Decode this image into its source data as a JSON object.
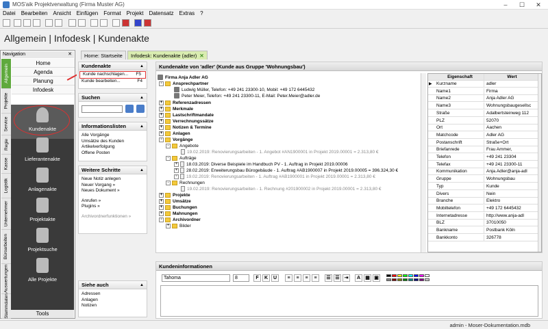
{
  "window": {
    "title": "MOS'aik Projektverwaltung (Firma Muster AG)",
    "minimize": "–",
    "maximize": "☐",
    "close": "✕"
  },
  "menu": [
    "Datei",
    "Bearbeiten",
    "Ansicht",
    "Einfügen",
    "Format",
    "Projekt",
    "Datensatz",
    "Extras",
    "?"
  ],
  "breadcrumb": "Allgemein | Infodesk | Kundenakte",
  "nav": {
    "header": "Navigation",
    "vtabs": [
      "Allgemein",
      "Projekte",
      "Service",
      "Regie",
      "Kasse",
      "Logistik",
      "Unternehmer",
      "Büroarbeiten",
      "Auswertungen",
      "Stammdaten"
    ],
    "items": [
      "Home",
      "Agenda",
      "Planung",
      "Infodesk"
    ],
    "big_items": [
      "Kundenakte",
      "Lieferantenakte",
      "Anlagenakte",
      "Projektakte",
      "Projektsuche",
      "Alle Projekte"
    ],
    "tools": "Tools"
  },
  "tabs": {
    "home": "Home: Startseite",
    "active": "Infodesk: Kundenakte (adler)"
  },
  "sidebar": {
    "kundenakte": {
      "title": "Kundenakte",
      "items": [
        {
          "label": "Kunde nachschlagen...",
          "key": "F5"
        },
        {
          "label": "Kunde bearbeiten...",
          "key": "F4"
        }
      ]
    },
    "suchen": {
      "title": "Suchen"
    },
    "infolisten": {
      "title": "Informationslisten",
      "items": [
        "Alle Vorgänge",
        "Umsätze des Kunden",
        "Artikelverfolgung",
        "Offene Posten"
      ]
    },
    "weitere": {
      "title": "Weitere Schritte",
      "items": [
        "Neue Notiz anlegen",
        "Neuer Vorgang »",
        "Neues Dokument »",
        "Anrufen »",
        "Plugins »",
        "Archivordnerfunktionen »"
      ]
    },
    "siehe": {
      "title": "Siehe auch",
      "items": [
        "Adressen",
        "Anlagen",
        "Notizen"
      ]
    }
  },
  "main": {
    "header": "Kundenakte von 'adler' (Kunde aus Gruppe 'Wohnungsbau')",
    "tree": {
      "root": "Firma Anja Adler AG",
      "ansprechpartner": "Ansprechpartner",
      "contacts": [
        "Ludwig Müller, Telefon: +49 241 23300-10, Mobil: +49 172 6445432",
        "Peter Meier, Telefon: +49 241 23300-11, E-Mail: Peter.Meier@adler.de"
      ],
      "sections": [
        "Referenzadressen",
        "Merkmale",
        "Lastschriftmandate",
        "Verrechnungssätze",
        "Notizen & Termine",
        "Anlagen"
      ],
      "vorgaenge": "Vorgänge",
      "angebote": "Angebote",
      "angebot1": "19.02.2019: Renovierungsarbeiten - 1. Angebot #AN1900001 in Projekt 2019.00001 = 2.313,80 €",
      "auftraege": "Aufträge",
      "auftrag1": "18.03.2019: Diverse Beispiele im Handbuch PV - 1. Auftrag in Projekt 2019.00006",
      "auftrag2": "28.02.2019: Erweiterungsbau Bürogebäude - 1. Auftrag #AB1900007 in Projekt 2019.00005 = 396.324,30 €",
      "auftrag3": "19.02.2019: Renovierungsarbeiten - 1. Auftrag #AB1900001 in Projekt 2019.00001 = 2.313,80 €",
      "rechnungen": "Rechnungen",
      "rechnung1": "19.02.2019: Renovierungsarbeiten - 1. Rechnung #201900002 in Projekt 2019.00001 = 2.313,80 €",
      "after": [
        "Projekte",
        "Umsätze",
        "Buchungen",
        "Mahnungen"
      ],
      "archiv": "Archivordner",
      "bilder": "Bilder"
    },
    "props": {
      "col_key": "Eigenschaft",
      "col_val": "Wert",
      "rows": [
        [
          "Kurzname",
          "adler"
        ],
        [
          "Name1",
          "Firma"
        ],
        [
          "Name2",
          "Anja Adler AG"
        ],
        [
          "Name3",
          "Wohnungsbaugesellsc"
        ],
        [
          "Straße",
          "Adalbertsteinweg 112"
        ],
        [
          "PLZ",
          "52070"
        ],
        [
          "Ort",
          "Aachen"
        ],
        [
          "Matchcode",
          "Adler AG"
        ],
        [
          "Postanschrift",
          "Straße+Ort"
        ],
        [
          "Briefanrede",
          "Frau Ammer,"
        ],
        [
          "Telefon",
          "+49 241 23304"
        ],
        [
          "Telefax",
          "+49 241 23300-11"
        ],
        [
          "Kommunikation",
          "Anja.Adler@anja-adl"
        ],
        [
          "Gruppe",
          "Wohnungsbau"
        ],
        [
          "Typ",
          "Kunde"
        ],
        [
          "Divers",
          "Nein"
        ],
        [
          "Branche",
          "Elektro"
        ],
        [
          "Mobiltelefon",
          "+49 172 6445432"
        ],
        [
          "Internetadresse",
          "http://www.anja-adl"
        ],
        [
          "BLZ",
          "37010050"
        ],
        [
          "Bankname",
          "Postbank Köln"
        ],
        [
          "Bankkonto",
          "326778"
        ]
      ]
    }
  },
  "info": {
    "header": "Kundeninformationen",
    "font": "Tahoma",
    "size": "8"
  },
  "status": "admin - Moser-Dokumentation.mdb",
  "colors": {
    "accent": "#5fa93d",
    "highlight": "#e03030",
    "dark": "#3a3a3a",
    "tab_active": "#d9ecb0"
  }
}
